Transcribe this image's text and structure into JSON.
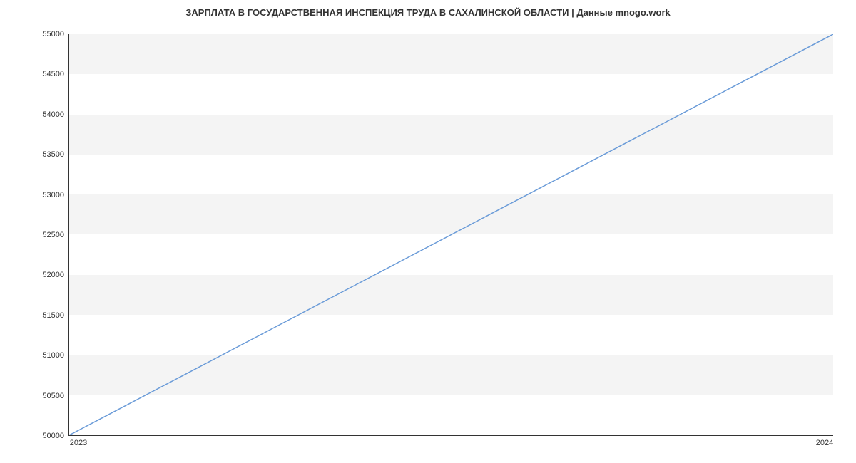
{
  "chart_data": {
    "type": "line",
    "title": "ЗАРПЛАТА В ГОСУДАРСТВЕННАЯ ИНСПЕКЦИЯ ТРУДА В САХАЛИНСКОЙ ОБЛАСТИ | Данные mnogo.work",
    "x": [
      "2023",
      "2024"
    ],
    "values": [
      50000,
      55000
    ],
    "xlabel": "",
    "ylabel": "",
    "ylim": [
      50000,
      55000
    ],
    "y_ticks": [
      50000,
      50500,
      51000,
      51500,
      52000,
      52500,
      53000,
      53500,
      54000,
      54500,
      55000
    ],
    "x_ticks": [
      "2023",
      "2024"
    ],
    "line_color": "#6a9bd8"
  }
}
